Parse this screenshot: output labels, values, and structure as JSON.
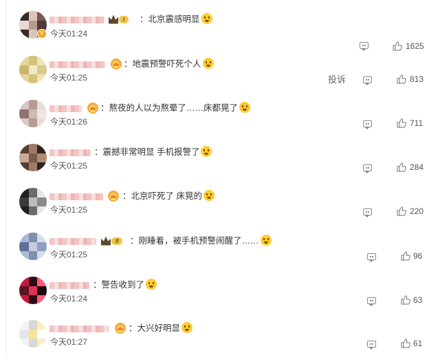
{
  "comments": [
    {
      "text": "：北京震感明显",
      "time": "今天01:24",
      "likes": "1625",
      "avatar_colors": [
        "#3a2a2a",
        "#d9c6bb",
        "#7a5a52",
        "#e8d8cf",
        "#b89a8c",
        "#4b3b34"
      ]
    },
    {
      "text": "：地震预警吓死个人",
      "time": "今天01:25",
      "likes": "813",
      "report": "投诉",
      "avatar_colors": [
        "#e6d59a",
        "#d2c27a",
        "#efe3b5",
        "#c9b66b",
        "#f1e8c4",
        "#d8ca8a"
      ]
    },
    {
      "text": "：熬夜的人以为熬晕了……床都晃了",
      "time": "今天01:26",
      "likes": "711",
      "avatar_colors": [
        "#d8c7c2",
        "#b39a93",
        "#e9dcd8",
        "#8d736c",
        "#cdbab4",
        "#efe6e3"
      ]
    },
    {
      "text": "：震撼非常明显 手机报警了",
      "time": "今天01:25",
      "likes": "284",
      "avatar_colors": [
        "#5a3d32",
        "#9e7a68",
        "#2f2420",
        "#c9a994",
        "#7b5a4b",
        "#b08a74"
      ]
    },
    {
      "text": "：北京吓死了 床晃的",
      "time": "今天01:25",
      "likes": "220",
      "avatar_colors": [
        "#1f1f1f",
        "#6b6b6b",
        "#e6e6e6",
        "#3a3a3a",
        "#bdbdbd",
        "#8a8a8a"
      ]
    },
    {
      "text": "：刚睡着，被手机预警闹醒了……",
      "time": "今天01:25",
      "likes": "96",
      "avatar_colors": [
        "#a9b9d6",
        "#7e8fb0",
        "#d4ddea",
        "#5f6f91",
        "#c2cde0",
        "#8fa0c0"
      ]
    },
    {
      "text": "：警告收到了",
      "time": "今天01:24",
      "likes": "63",
      "avatar_colors": [
        "#c21b3a",
        "#2a0d14",
        "#ff5a7a",
        "#5c1325",
        "#e03253",
        "#1a0a0f"
      ]
    },
    {
      "text": "：大兴好明显",
      "time": "今天01:27",
      "likes": "61",
      "avatar_colors": [
        "#f2f2f2",
        "#d8d8d8",
        "#fbeec0",
        "#e6e6e6",
        "#f7e39a",
        "#ffffff"
      ]
    }
  ],
  "colors": {
    "icon_gray": "#8a8a8a",
    "vip_orange": "#f5a623",
    "crown_gold": "#f0c34a"
  },
  "icons": {
    "comment": "comment-icon",
    "like": "thumbs-up-icon",
    "verified": "verified-v-icon"
  },
  "badges": [
    "I",
    "II"
  ]
}
